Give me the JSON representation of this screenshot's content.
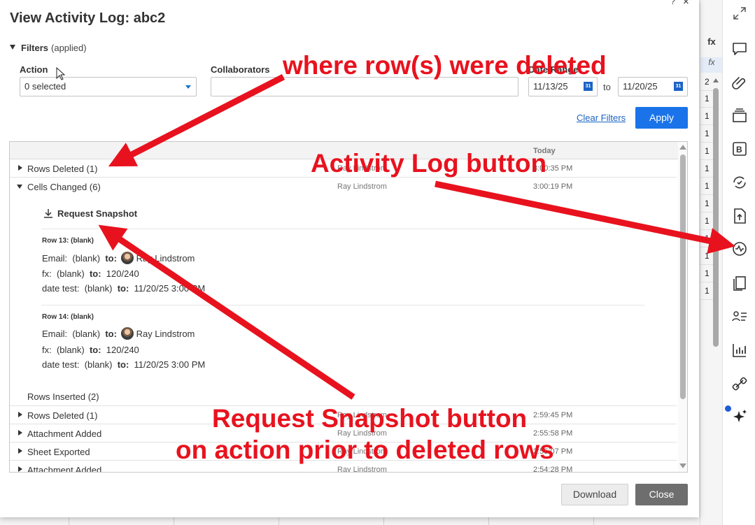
{
  "dialog": {
    "title": "View Activity Log: abc2",
    "help": "?",
    "close_x": "×"
  },
  "filters": {
    "label": "Filters",
    "status": "(applied)",
    "action_label": "Action",
    "action_value": "0 selected",
    "collaborators_label": "Collaborators",
    "collaborators_value": "",
    "date_range_label": "Date Range",
    "date_from": "11/13/25",
    "to": "to",
    "date_to": "11/20/25",
    "calendar_glyph": "31",
    "clear": "Clear Filters",
    "apply": "Apply"
  },
  "log": {
    "today": "Today",
    "entries": [
      {
        "label": "Rows Deleted (1)",
        "who": "Ray Lindstrom",
        "when": "3:00:35 PM"
      },
      {
        "label": "Cells Changed (6)",
        "who": "Ray Lindstrom",
        "when": "3:00:19 PM"
      },
      {
        "label": "Rows Deleted (1)",
        "who": "Ray Lindstrom",
        "when": "2:59:45 PM"
      },
      {
        "label": "Attachment Added",
        "who": "Ray Lindstrom",
        "when": "2:55:58 PM"
      },
      {
        "label": "Sheet Exported",
        "who": "Ray Lindstrom",
        "when": "2:55:07 PM"
      },
      {
        "label": "Attachment Added",
        "who": "Ray Lindstrom",
        "when": "2:54:28 PM"
      }
    ],
    "snapshot": "Request Snapshot",
    "rows_inserted": "Rows Inserted (2)",
    "changes": [
      {
        "row": "Row 13: (blank)",
        "lines": [
          {
            "field": "Email:",
            "from": "(blank)",
            "to": "to:",
            "value": "Ray Lindstrom"
          },
          {
            "field": "fx:",
            "from": "(blank)",
            "to": "to:",
            "value": "120/240"
          },
          {
            "field": "date test:",
            "from": "(blank)",
            "to": "to:",
            "value": "11/20/25 3:00 PM"
          }
        ]
      },
      {
        "row": "Row 14: (blank)",
        "lines": [
          {
            "field": "Email:",
            "from": "(blank)",
            "to": "to:",
            "value": "Ray Lindstrom"
          },
          {
            "field": "fx:",
            "from": "(blank)",
            "to": "to:",
            "value": "120/240"
          },
          {
            "field": "date test:",
            "from": "(blank)",
            "to": "to:",
            "value": "11/20/25 3:00 PM"
          }
        ]
      }
    ]
  },
  "footer": {
    "download": "Download",
    "close": "Close"
  },
  "sheet": {
    "fx_header": "fx",
    "fx_row": "fx",
    "cells": [
      "2",
      "1",
      "1",
      "1",
      "1",
      "1",
      "1",
      "1",
      "1",
      "1",
      "1",
      "1",
      "1"
    ]
  },
  "toolbar": {
    "icons": [
      "comments-icon",
      "attachments-icon",
      "proofing-icon",
      "brandfolder-icon",
      "update-requests-icon",
      "publish-icon",
      "activity-log-icon",
      "summary-icon",
      "contacts-icon",
      "chart-icon",
      "connections-icon",
      "ai-sparkle-icon"
    ],
    "expand": "expand-icon"
  },
  "annotations": {
    "deleted": "where row(s) were deleted",
    "activity": "Activity Log button",
    "snapshot_line1": "Request Snapshot button",
    "snapshot_line2": "on action prior to deleted rows",
    "color": "#e8121e"
  }
}
